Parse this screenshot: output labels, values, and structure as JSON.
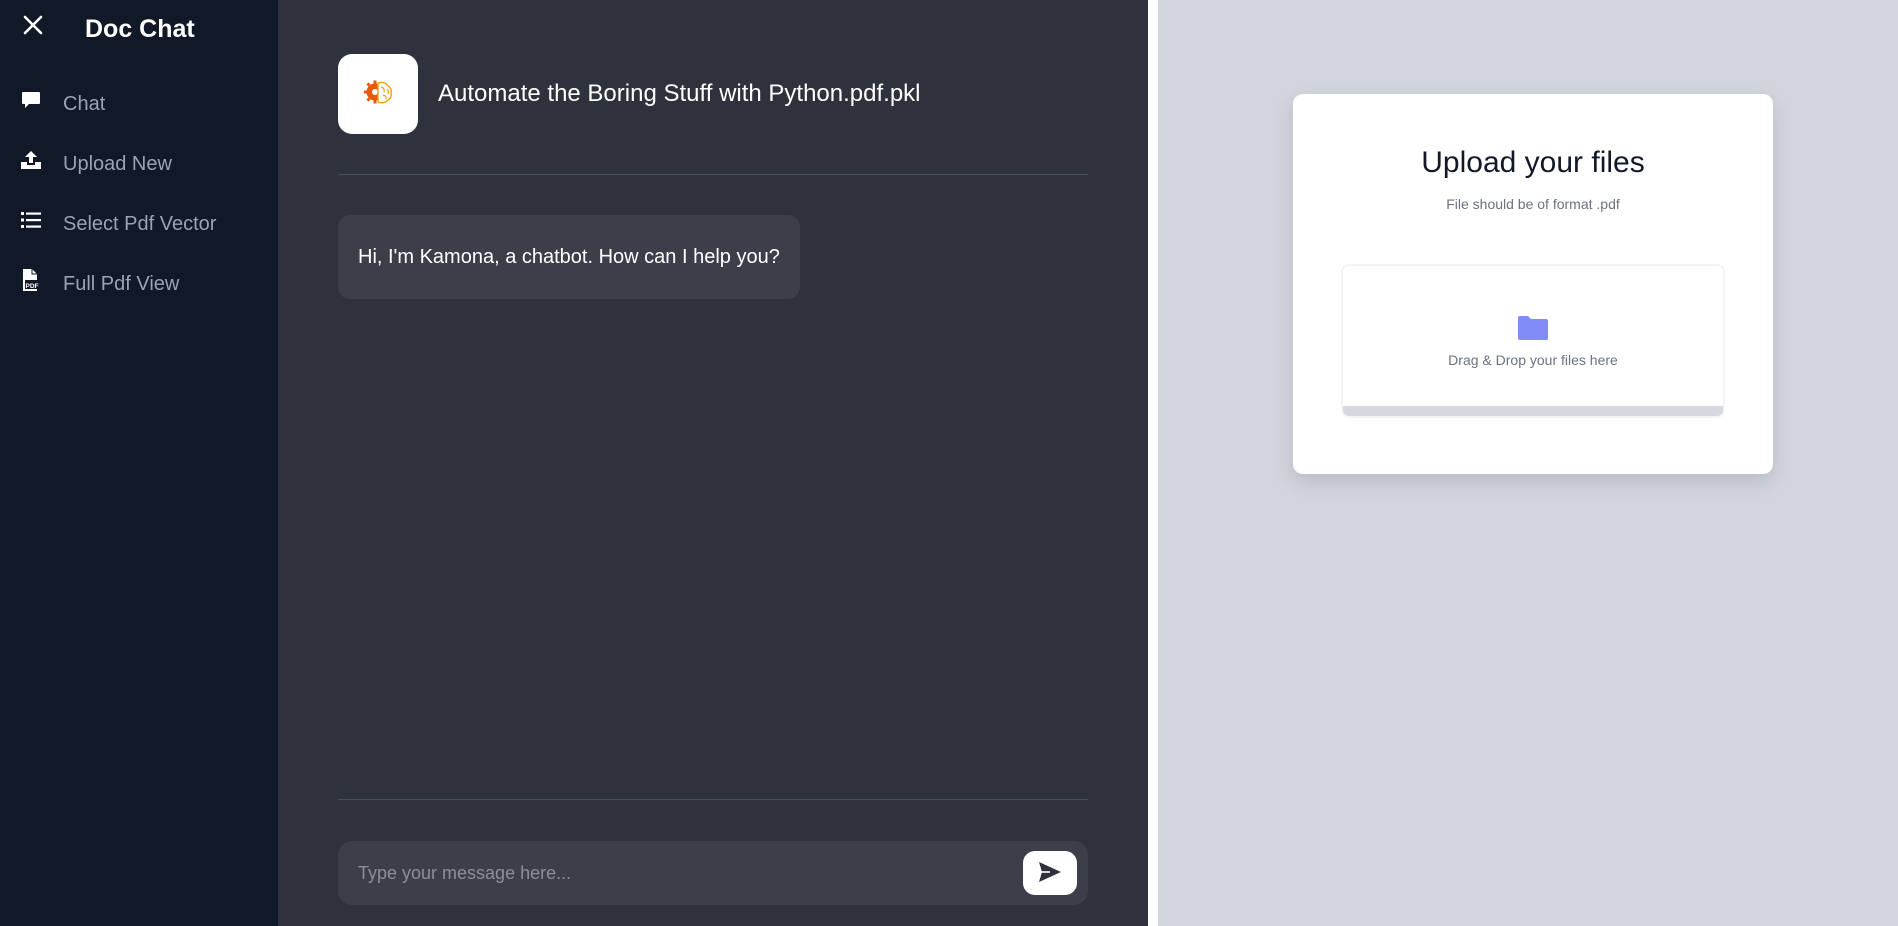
{
  "sidebar": {
    "title": "Doc Chat",
    "items": [
      {
        "label": "Chat",
        "icon": "chat-bubble-icon"
      },
      {
        "label": "Upload New",
        "icon": "upload-icon"
      },
      {
        "label": "Select Pdf Vector",
        "icon": "list-icon"
      },
      {
        "label": "Full Pdf View",
        "icon": "pdf-file-icon"
      }
    ]
  },
  "chat": {
    "document_title": "Automate the Boring Stuff with Python.pdf.pkl",
    "messages": [
      {
        "role": "bot",
        "text": "Hi, I'm Kamona, a chatbot. How can I help you?"
      }
    ],
    "input_placeholder": "Type your message here...",
    "input_value": ""
  },
  "upload": {
    "title": "Upload your files",
    "subtitle": "File should be of format .pdf",
    "drop_text": "Drag & Drop your files here",
    "progress": 0
  },
  "colors": {
    "sidebar_bg": "#111827",
    "chat_bg": "#2e323c",
    "bubble_bg": "#3b3f49",
    "right_bg": "#d1d5de",
    "folder_accent": "#818cf8",
    "brand_orange": "#ea580c"
  }
}
